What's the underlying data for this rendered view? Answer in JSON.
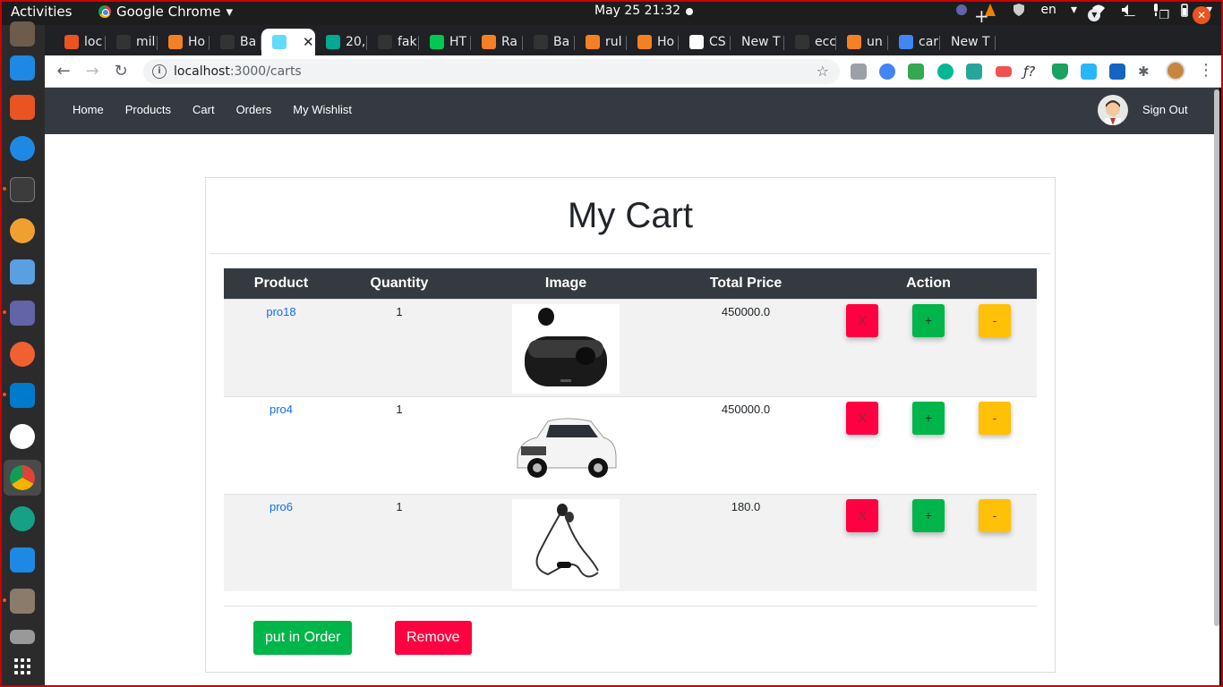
{
  "system": {
    "activities": "Activities",
    "app_name": "Google Chrome",
    "clock": "May 25  21:32",
    "lang": "en"
  },
  "tabs": [
    {
      "label": "loc",
      "color": "#e95420"
    },
    {
      "label": "mil",
      "color": "#333333"
    },
    {
      "label": "Ho",
      "color": "#f48024"
    },
    {
      "label": "Ba",
      "color": "#333333"
    },
    {
      "label": "",
      "color": "#61dafb",
      "active": true
    },
    {
      "label": "20,",
      "color": "#00a98f"
    },
    {
      "label": "fak",
      "color": "#333333"
    },
    {
      "label": "HT",
      "color": "#00c853"
    },
    {
      "label": "Ra",
      "color": "#f48024"
    },
    {
      "label": "Ba",
      "color": "#333333"
    },
    {
      "label": "rul",
      "color": "#f48024"
    },
    {
      "label": "Ho",
      "color": "#f48024"
    },
    {
      "label": "CS",
      "color": "#ffffff"
    },
    {
      "label": "New T",
      "color": ""
    },
    {
      "label": "ecc",
      "color": "#333333"
    },
    {
      "label": "un",
      "color": "#f48024"
    },
    {
      "label": "car",
      "color": "#4285f4"
    },
    {
      "label": "New T",
      "color": ""
    }
  ],
  "address": {
    "host": "localhost",
    "path": ":3000/carts"
  },
  "navbar": {
    "links": [
      "Home",
      "Products",
      "Cart",
      "Orders",
      "My Wishlist"
    ],
    "signout": "Sign Out"
  },
  "cart": {
    "title": "My Cart",
    "headers": [
      "Product",
      "Quantity",
      "Image",
      "Total Price",
      "Action"
    ],
    "rows": [
      {
        "product": "pro18",
        "quantity": "1",
        "image": "earbuds-image",
        "total": "450000.0"
      },
      {
        "product": "pro4",
        "quantity": "1",
        "image": "car-image",
        "total": "450000.0"
      },
      {
        "product": "pro6",
        "quantity": "1",
        "image": "earphones-image",
        "total": "180.0"
      }
    ],
    "action_labels": {
      "remove": "X",
      "increase": "+",
      "decrease": "-"
    },
    "order_button": "put in Order",
    "remove_button": "Remove"
  },
  "colors": {
    "navbar": "#343a40",
    "success": "#00b54a",
    "danger": "#ff0040",
    "warning": "#ffc107",
    "link": "#0d6efd"
  }
}
